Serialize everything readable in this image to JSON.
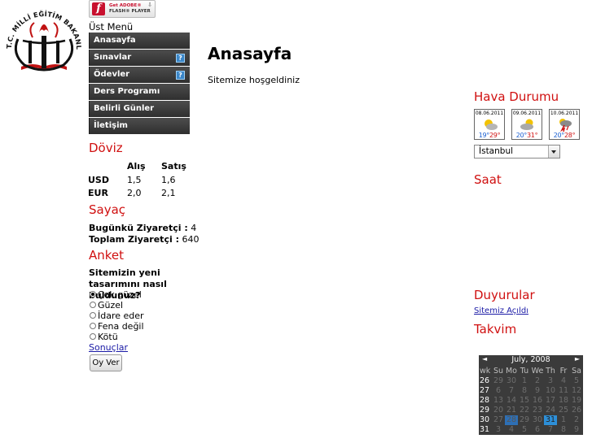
{
  "logo": {
    "arc_text": "T.C. MİLLİ EĞİTİM BAKANLIĞI",
    "icon": "ministry-seal-icon"
  },
  "flash": {
    "line1": "Get ADOBE®",
    "line2": "FLASH® PLAYER",
    "icon": "flash-icon"
  },
  "menu": {
    "title": "Üst Menü",
    "items": [
      {
        "label": "Anasayfa",
        "help": false
      },
      {
        "label": "Sınavlar",
        "help": true
      },
      {
        "label": "Ödevler",
        "help": true
      },
      {
        "label": "Ders Programı",
        "help": false
      },
      {
        "label": "Belirli Günler",
        "help": false
      },
      {
        "label": "İletişim",
        "help": false
      }
    ],
    "help_glyph": "?"
  },
  "page": {
    "title": "Anasayfa",
    "welcome": "Sitemize hoşgeldiniz"
  },
  "doviz": {
    "title": "Döviz",
    "headers": [
      "",
      "Alış",
      "Satış"
    ],
    "rows": [
      {
        "code": "USD",
        "buy": "1,5",
        "sell": "1,6"
      },
      {
        "code": "EUR",
        "buy": "2,0",
        "sell": "2,1"
      }
    ]
  },
  "sayac": {
    "title": "Sayaç",
    "today_label": "Bugünkü Ziyaretçi :",
    "today_value": "4",
    "total_label": "Toplam Ziyaretçi :",
    "total_value": "640"
  },
  "anket": {
    "title": "Anket",
    "question": "Sitemizin yeni tasarımını nasıl buldunuz?",
    "options": [
      "Çok güzel",
      "Güzel",
      "İdare eder",
      "Fena değil",
      "Kötü"
    ],
    "selected_index": 0,
    "results_link": "Sonuçlar",
    "vote_button": "Oy Ver"
  },
  "hava": {
    "title": "Hava Durumu",
    "days": [
      {
        "date": "08.06.2011",
        "low": "19°",
        "high": "29°",
        "icon": "sun-cloud-icon"
      },
      {
        "date": "09.06.2011",
        "low": "20°",
        "high": "31°",
        "icon": "partly-cloudy-icon"
      },
      {
        "date": "10.06.2011",
        "low": "20°",
        "high": "28°",
        "icon": "storm-icon"
      }
    ],
    "city": "İstanbul"
  },
  "saat": {
    "title": "Saat"
  },
  "duyurular": {
    "title": "Duyurular",
    "link": "Sitemiz Açıldı"
  },
  "takvim": {
    "title": "Takvim",
    "month_label": "July, 2008",
    "prev": "◄",
    "next": "►",
    "day_headers": [
      "wk",
      "Su",
      "Mo",
      "Tu",
      "We",
      "Th",
      "Fr",
      "Sa"
    ],
    "weeks": [
      {
        "wk": "26",
        "days": [
          "29",
          "30",
          "1",
          "2",
          "3",
          "4",
          "5"
        ]
      },
      {
        "wk": "27",
        "days": [
          "6",
          "7",
          "8",
          "9",
          "10",
          "11",
          "12"
        ]
      },
      {
        "wk": "28",
        "days": [
          "13",
          "14",
          "15",
          "16",
          "17",
          "18",
          "19"
        ]
      },
      {
        "wk": "29",
        "days": [
          "20",
          "21",
          "22",
          "23",
          "24",
          "25",
          "26"
        ]
      },
      {
        "wk": "30",
        "days": [
          "27",
          "28",
          "29",
          "30",
          "31",
          "1",
          "2"
        ]
      },
      {
        "wk": "31",
        "days": [
          "3",
          "4",
          "5",
          "6",
          "7",
          "8",
          "9"
        ]
      }
    ],
    "colors": {
      "bg": "#3b3b3b",
      "selected": "#2d6fb5",
      "today": "#2d8fd8"
    }
  },
  "colors": {
    "section_heading": "#d01010",
    "link": "#1a1aa6",
    "menu_bg": "#3a3a3a"
  }
}
